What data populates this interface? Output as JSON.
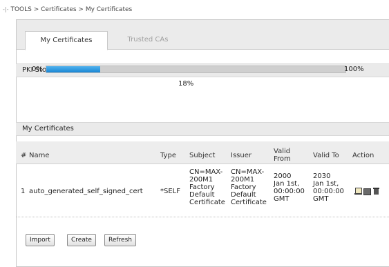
{
  "breadcrumb": "TOOLS > Certificates > My Certificates",
  "tabs": [
    {
      "label": "My Certificates",
      "active": true
    },
    {
      "label": "Trusted CAs",
      "active": false
    }
  ],
  "storage": {
    "heading": "PKI Storage Space in Use",
    "min_label": "0%",
    "max_label": "100%",
    "used_label": "18%",
    "used_fraction": 0.18,
    "fill_color": "#1a86d2"
  },
  "certificates": {
    "heading": "My Certificates",
    "columns": [
      "#",
      "Name",
      "Type",
      "Subject",
      "Issuer",
      "Valid From",
      "Valid To",
      "Action"
    ],
    "rows": [
      {
        "index": "1",
        "name": "auto_generated_self_signed_cert",
        "type": "*SELF",
        "subject": [
          "CN=MAX-",
          "200M1",
          "Factory",
          "Default",
          "Certificate"
        ],
        "issuer": [
          "CN=MAX-",
          "200M1",
          "Factory",
          "Default",
          "Certificate"
        ],
        "valid_from": [
          "2000",
          "Jan 1st,",
          "00:00:00",
          "GMT"
        ],
        "valid_to": [
          "2030",
          "Jan 1st,",
          "00:00:00",
          "GMT"
        ],
        "actions": [
          "edit-icon",
          "export-icon",
          "delete-icon"
        ]
      }
    ]
  },
  "buttons": {
    "import": "Import",
    "create": "Create",
    "refresh": "Refresh"
  }
}
